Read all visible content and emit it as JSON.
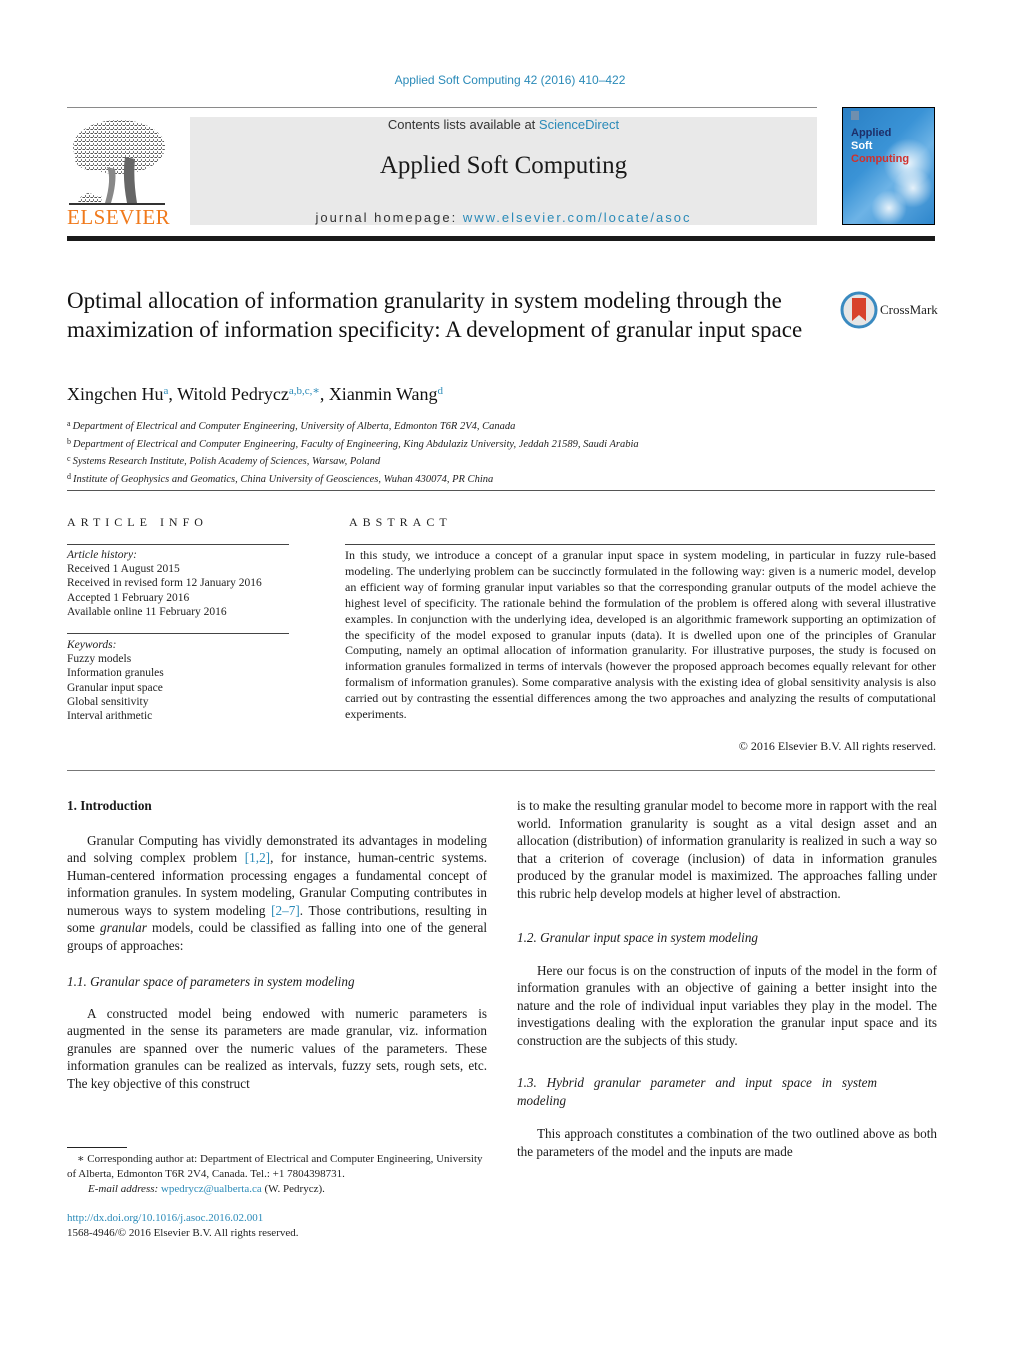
{
  "header": {
    "citation": "Applied Soft Computing 42 (2016) 410–422",
    "contents_prefix": "Contents lists available at ",
    "contents_link": "ScienceDirect",
    "journal_title": "Applied Soft Computing",
    "homepage_prefix": "journal homepage: ",
    "homepage_link": "www.elsevier.com/locate/asoc",
    "publisher_logo_text": "ELSEVIER",
    "cover": {
      "line1": "Applied",
      "line2": "Soft",
      "line3": "Computing"
    },
    "colors": {
      "link": "#2a8ab8",
      "elsevier_orange": "#f07a1c",
      "cover_blue": "#2a7fc4",
      "cover_red": "#d0312d"
    }
  },
  "article": {
    "title": "Optimal allocation of information granularity in system modeling through the maximization of information specificity: A development of granular input space",
    "crossmark_label": "CrossMark",
    "authors": [
      {
        "name": "Xingchen Hu",
        "sup": "a"
      },
      {
        "name": "Witold Pedrycz",
        "sup": "a,b,c,∗"
      },
      {
        "name": "Xianmin Wang",
        "sup": "d"
      }
    ],
    "affiliations": [
      {
        "key": "a",
        "text": "Department of Electrical and Computer Engineering, University of Alberta, Edmonton T6R 2V4, Canada"
      },
      {
        "key": "b",
        "text": "Department of Electrical and Computer Engineering, Faculty of Engineering, King Abdulaziz University, Jeddah 21589, Saudi Arabia"
      },
      {
        "key": "c",
        "text": "Systems Research Institute, Polish Academy of Sciences, Warsaw, Poland"
      },
      {
        "key": "d",
        "text": "Institute of Geophysics and Geomatics, China University of Geosciences, Wuhan 430074, PR China"
      }
    ]
  },
  "article_info": {
    "heading": "ARTICLE INFO",
    "history_label": "Article history:",
    "history": [
      "Received 1 August 2015",
      "Received in revised form 12 January 2016",
      "Accepted 1 February 2016",
      "Available online 11 February 2016"
    ],
    "keywords_label": "Keywords:",
    "keywords": [
      "Fuzzy models",
      "Information granules",
      "Granular input space",
      "Global sensitivity",
      "Interval arithmetic"
    ]
  },
  "abstract": {
    "heading": "ABSTRACT",
    "text": "In this study, we introduce a concept of a granular input space in system modeling, in particular in fuzzy rule-based modeling. The underlying problem can be succinctly formulated in the following way: given is a numeric model, develop an efficient way of forming granular input variables so that the cor­responding granular outputs of the model achieve the highest level of specificity. The rationale behind the formulation of the problem is offered along with several illustrative examples. In conjunction with the underlying idea, developed is an algorithmic framework supporting an optimization of the speci­ficity of the model exposed to granular inputs (data). It is dwelled upon one of the principles of Granular Computing, namely an optimal allocation of information granularity. For illustrative purposes, the study is focused on information granules formalized in terms of intervals (however the proposed approach becomes equally relevant for other formalism of information granules). Some comparative analysis with the existing idea of global sensitivity analysis is also carried out by contrasting the essential differences among the two approaches and analyzing the results of computational experiments.",
    "copyright": "© 2016 Elsevier B.V. All rights reserved."
  },
  "body": {
    "section1_heading": "1.  Introduction",
    "intro_p1": {
      "a": "Granular Computing has vividly demonstrated its advantages in modeling and solving complex problem ",
      "ref1": "[1,2]",
      "b": ", for instance, human-centric systems. Human-centered information processing engages a fundamental concept of information granules. In system model­ing, Granular Computing contributes in numerous ways to system modeling ",
      "ref2": "[2–7]",
      "c": ". Those contributions, resulting in some ",
      "em": "granular",
      "d": " models, could be classified as falling into one of the general groups of approaches:"
    },
    "sub11_heading": "1.1.  Granular space of parameters in system modeling",
    "sub11_p": "A constructed model being endowed with numeric parameters is augmented in the sense its parameters are made granular, viz. information granules are spanned over the numeric values of the parameters. These information granules can be realized as inter­vals, fuzzy sets, rough sets, etc. The key objective of this construct",
    "col2_cont": "is to make the resulting granular model to become more in rap­port with the real world. Information granularity is sought as a vital design asset and an allocation (distribution) of information granularity is realized in such a way so that a criterion of coverage (inclusion) of data in information granules produced by the gran­ular model is maximized. The approaches falling under this rubric help develop models at higher level of abstraction.",
    "sub12_heading": "1.2.  Granular input space in system modeling",
    "sub12_p": "Here our focus is on the construction of inputs of the model in the form of information granules with an objective of gaining a better insight into the nature and the role of individual input variables they play in the model. The investigations dealing with the exploration the granular input space and its construction are the subjects of this study.",
    "sub13_heading": "1.3.  Hybrid granular parameter and input space in system modeling",
    "sub13_p": "This approach constitutes a combination of the two outlined above as both the parameters of the model and the inputs are made"
  },
  "footnote": {
    "corresponding": "∗  Corresponding author at: Department of Electrical and Computer Engineering, University of Alberta, Edmonton T6R 2V4, Canada. Tel.: +1 7804398731.",
    "email_label": "E-mail address: ",
    "email": "wpedrycz@ualberta.ca",
    "email_suffix": " (W. Pedrycz).",
    "doi": "http://dx.doi.org/10.1016/j.asoc.2016.02.001",
    "issn": "1568-4946/© 2016 Elsevier B.V. All rights reserved."
  }
}
